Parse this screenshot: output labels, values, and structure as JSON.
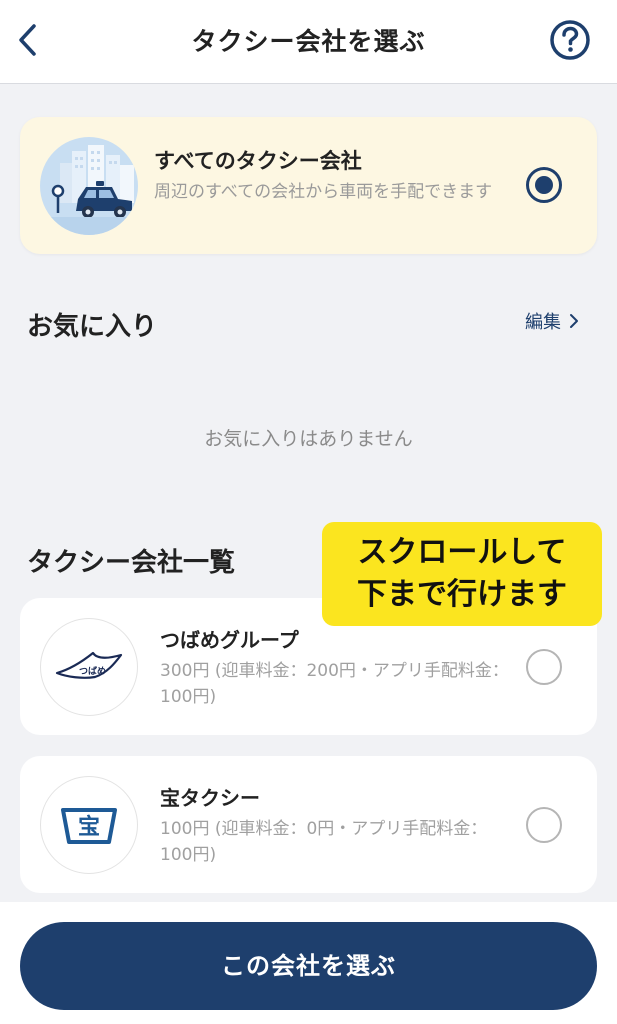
{
  "header": {
    "title": "タクシー会社を選ぶ",
    "back_icon": "chevron-left-icon",
    "help_icon": "question-circle-icon"
  },
  "all_companies": {
    "title": "すべてのタクシー会社",
    "description": "周辺のすべての会社から車両を手配できます",
    "selected": true
  },
  "favorites": {
    "title": "お気に入り",
    "edit_label": "編集",
    "empty_message": "お気に入りはありません"
  },
  "company_list": {
    "title": "タクシー会社一覧",
    "items": [
      {
        "name": "つばめグループ",
        "price": "300円 (迎車料金：200円・アプリ手配料金：100円)",
        "logo_text": "つばめ",
        "selected": false
      },
      {
        "name": "宝タクシー",
        "price": "100円 (迎車料金：0円・アプリ手配料金：100円)",
        "logo_text": "宝",
        "selected": false
      }
    ]
  },
  "note": {
    "line1": "スクロールして",
    "line2": "下まで行けます"
  },
  "footer": {
    "select_button": "この会社を選ぶ"
  },
  "colors": {
    "primary": "#1e3f6d",
    "highlight_card": "#fdf7e2",
    "note_yellow": "#fbe51f",
    "background": "#f1f2f5"
  }
}
